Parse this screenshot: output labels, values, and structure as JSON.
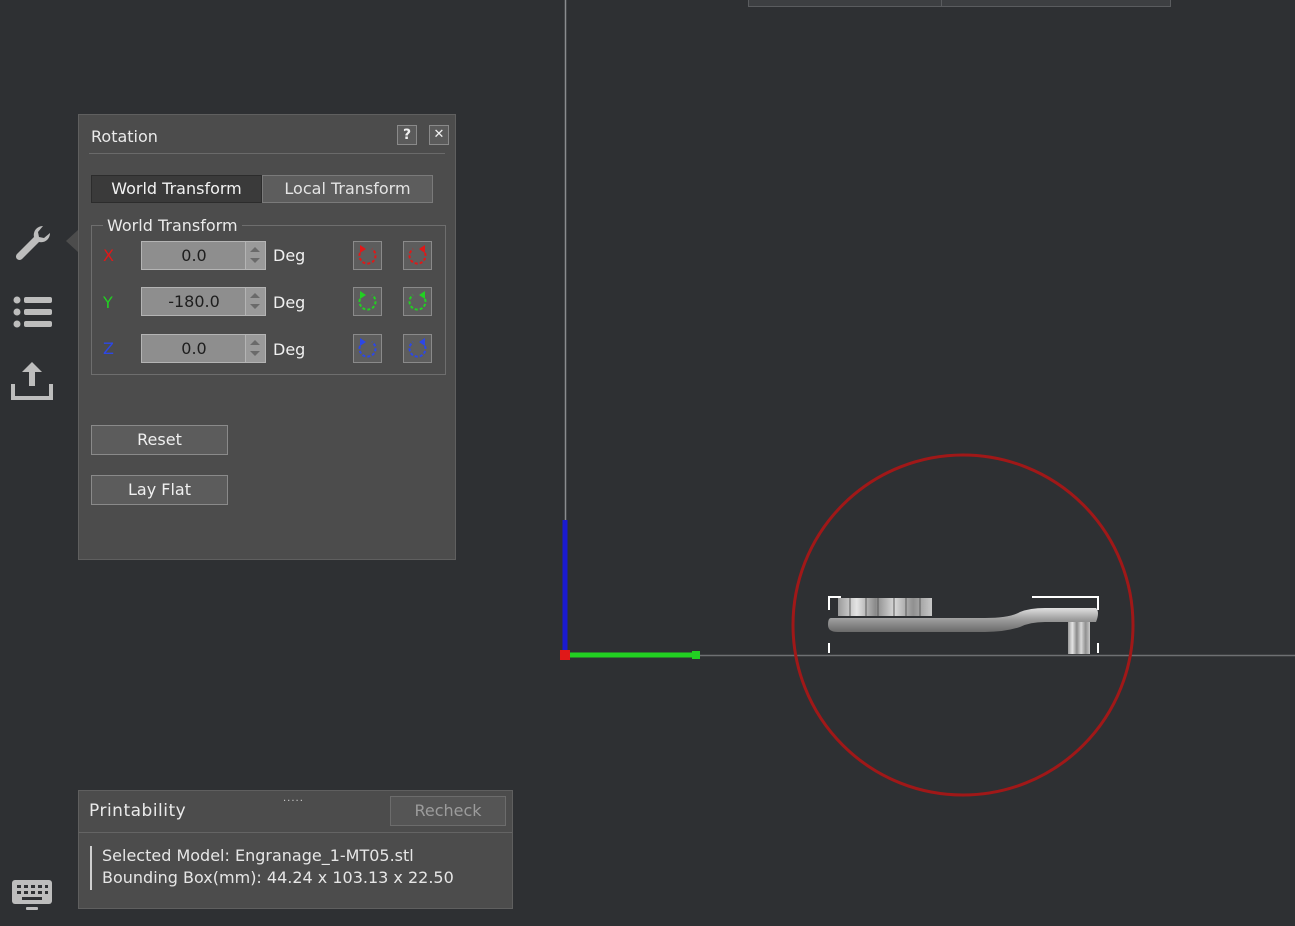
{
  "rotation_panel": {
    "title": "Rotation",
    "help_label": "?",
    "close_label": "✕",
    "tabs": [
      {
        "label": "World Transform",
        "active": true
      },
      {
        "label": "Local Transform",
        "active": false
      }
    ],
    "group_title": "World Transform",
    "axes": [
      {
        "label": "X",
        "value": "0.0",
        "unit": "Deg",
        "color": "#e01818"
      },
      {
        "label": "Y",
        "value": "-180.0",
        "unit": "Deg",
        "color": "#22d022"
      },
      {
        "label": "Z",
        "value": "0.0",
        "unit": "Deg",
        "color": "#2c47e6"
      }
    ],
    "reset_label": "Reset",
    "lay_flat_label": "Lay Flat"
  },
  "printability": {
    "title": "Printability",
    "grip": ".....",
    "recheck_label": "Recheck",
    "selected_model": "Selected Model: Engranage_1-MT05.stl",
    "bounding_box": "Bounding Box(mm): 44.24 x 103.13 x 22.50"
  },
  "toolbar": {
    "items": [
      {
        "icon": "wrench-icon"
      },
      {
        "icon": "list-icon"
      },
      {
        "icon": "export-icon"
      }
    ],
    "keyboard_icon": "keyboard-icon"
  },
  "viewport": {
    "axis_colors": {
      "x": "#22d022",
      "z": "#1a1ad0",
      "origin": "#e01818"
    },
    "selection_circle_color": "#a01818",
    "background": "#2e3033"
  }
}
